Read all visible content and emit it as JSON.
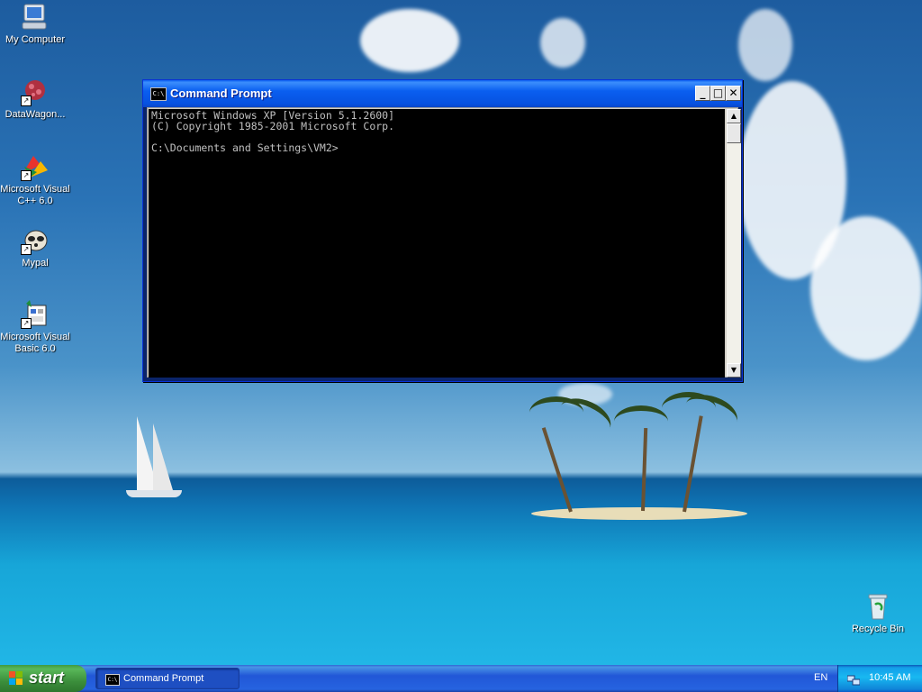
{
  "desktop": {
    "icons": [
      {
        "label": "My Computer",
        "icon": "my-computer-icon"
      },
      {
        "label": "DataWagon...",
        "icon": "datawagon-icon"
      },
      {
        "label": "Microsoft Visual C++ 6.0",
        "icon": "visual-cpp-icon"
      },
      {
        "label": "Mypal",
        "icon": "mypal-icon"
      },
      {
        "label": "Microsoft Visual Basic 6.0",
        "icon": "visual-basic-icon"
      }
    ],
    "recycle_bin": {
      "label": "Recycle Bin",
      "icon": "recycle-bin-icon"
    }
  },
  "window": {
    "title": "Command Prompt",
    "icon_text": "C:\\",
    "buttons": {
      "minimize": "_",
      "maximize": "□",
      "close": "✕"
    },
    "console_lines": [
      "Microsoft Windows XP [Version 5.1.2600]",
      "(C) Copyright 1985-2001 Microsoft Corp.",
      "",
      "C:\\Documents and Settings\\VM2>"
    ],
    "scroll_up": "▲",
    "scroll_down": "▼"
  },
  "taskbar": {
    "start_label": "start",
    "task_label": "Command Prompt",
    "task_icon_text": "C:\\",
    "language": "EN",
    "clock": "10:45 AM"
  },
  "colors": {
    "console_bg": "#000000",
    "console_text": "#c0c0c0",
    "taskbar_blue": "#2157d7",
    "start_green": "#3c8f3c"
  }
}
